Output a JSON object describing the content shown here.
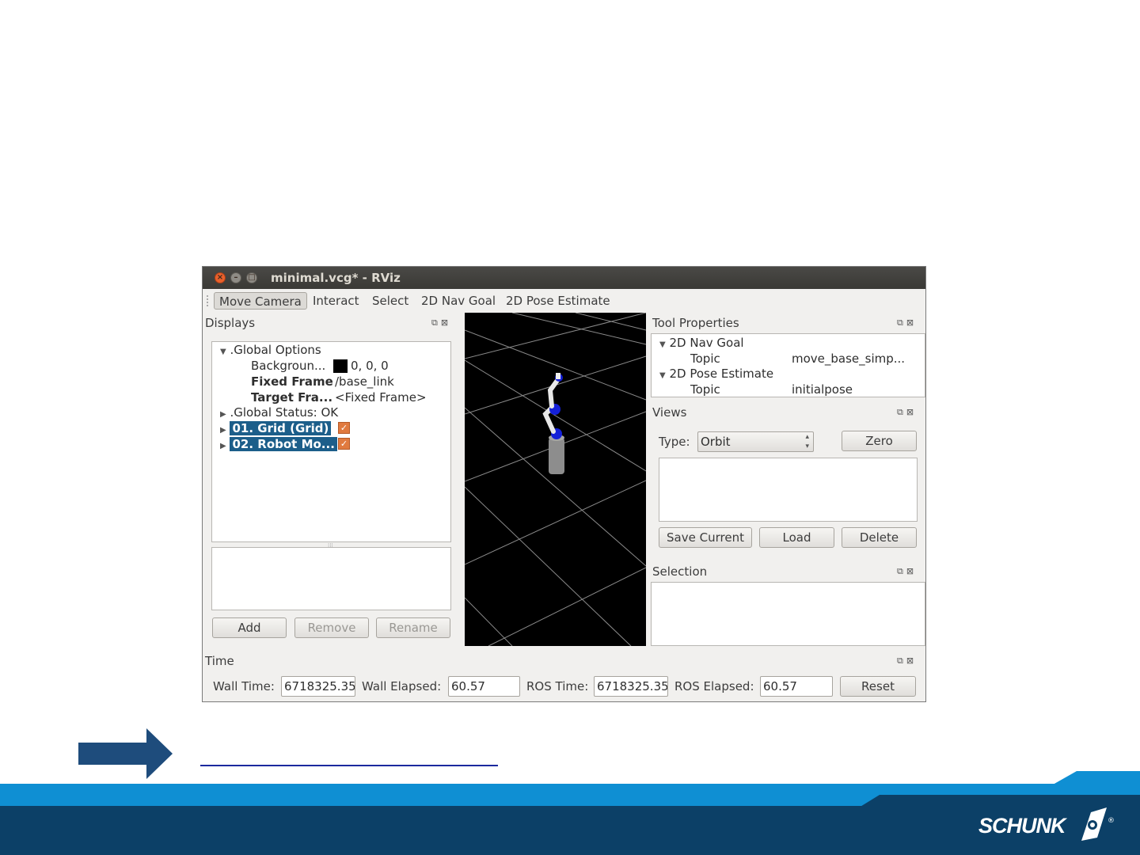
{
  "window": {
    "title": "minimal.vcg* - RViz"
  },
  "toolbar": {
    "items": [
      "Move Camera",
      "Interact",
      "Select",
      "2D Nav Goal",
      "2D Pose Estimate"
    ]
  },
  "displays": {
    "title": "Displays",
    "global_options": ".Global Options",
    "background_label": "Backgroun...",
    "background_value": "0, 0, 0",
    "fixed_frame_label": "Fixed Frame",
    "fixed_frame_value": "/base_link",
    "target_frame_label": "Target Fra...",
    "target_frame_value": "<Fixed Frame>",
    "global_status": ".Global Status: OK",
    "grid": "01. Grid (Grid)",
    "robot_model": "02. Robot Mo...",
    "buttons": {
      "add": "Add",
      "remove": "Remove",
      "rename": "Rename"
    }
  },
  "tool_properties": {
    "title": "Tool Properties",
    "nav_goal": "2D Nav Goal",
    "topic_label": "Topic",
    "nav_goal_topic": "move_base_simp...",
    "pose_estimate": "2D Pose Estimate",
    "pose_estimate_topic": "initialpose"
  },
  "views": {
    "title": "Views",
    "type_label": "Type:",
    "type_value": "Orbit",
    "zero": "Zero",
    "save_current": "Save Current",
    "load": "Load",
    "delete": "Delete"
  },
  "selection": {
    "title": "Selection"
  },
  "time": {
    "title": "Time",
    "wall_time_label": "Wall Time:",
    "wall_time_value": "6718325.35",
    "wall_elapsed_label": "Wall Elapsed:",
    "wall_elapsed_value": "60.57",
    "ros_time_label": "ROS Time:",
    "ros_time_value": "6718325.35",
    "ros_elapsed_label": "ROS Elapsed:",
    "ros_elapsed_value": "60.57",
    "reset": "Reset"
  },
  "brand": {
    "logo_text": "SCHUNK",
    "registered": "®"
  },
  "colors": {
    "light_band": "#0f8fd3",
    "dark_band": "#0c4067",
    "arrow": "#1e4c7c",
    "link_underline": "#1b2a9e"
  }
}
